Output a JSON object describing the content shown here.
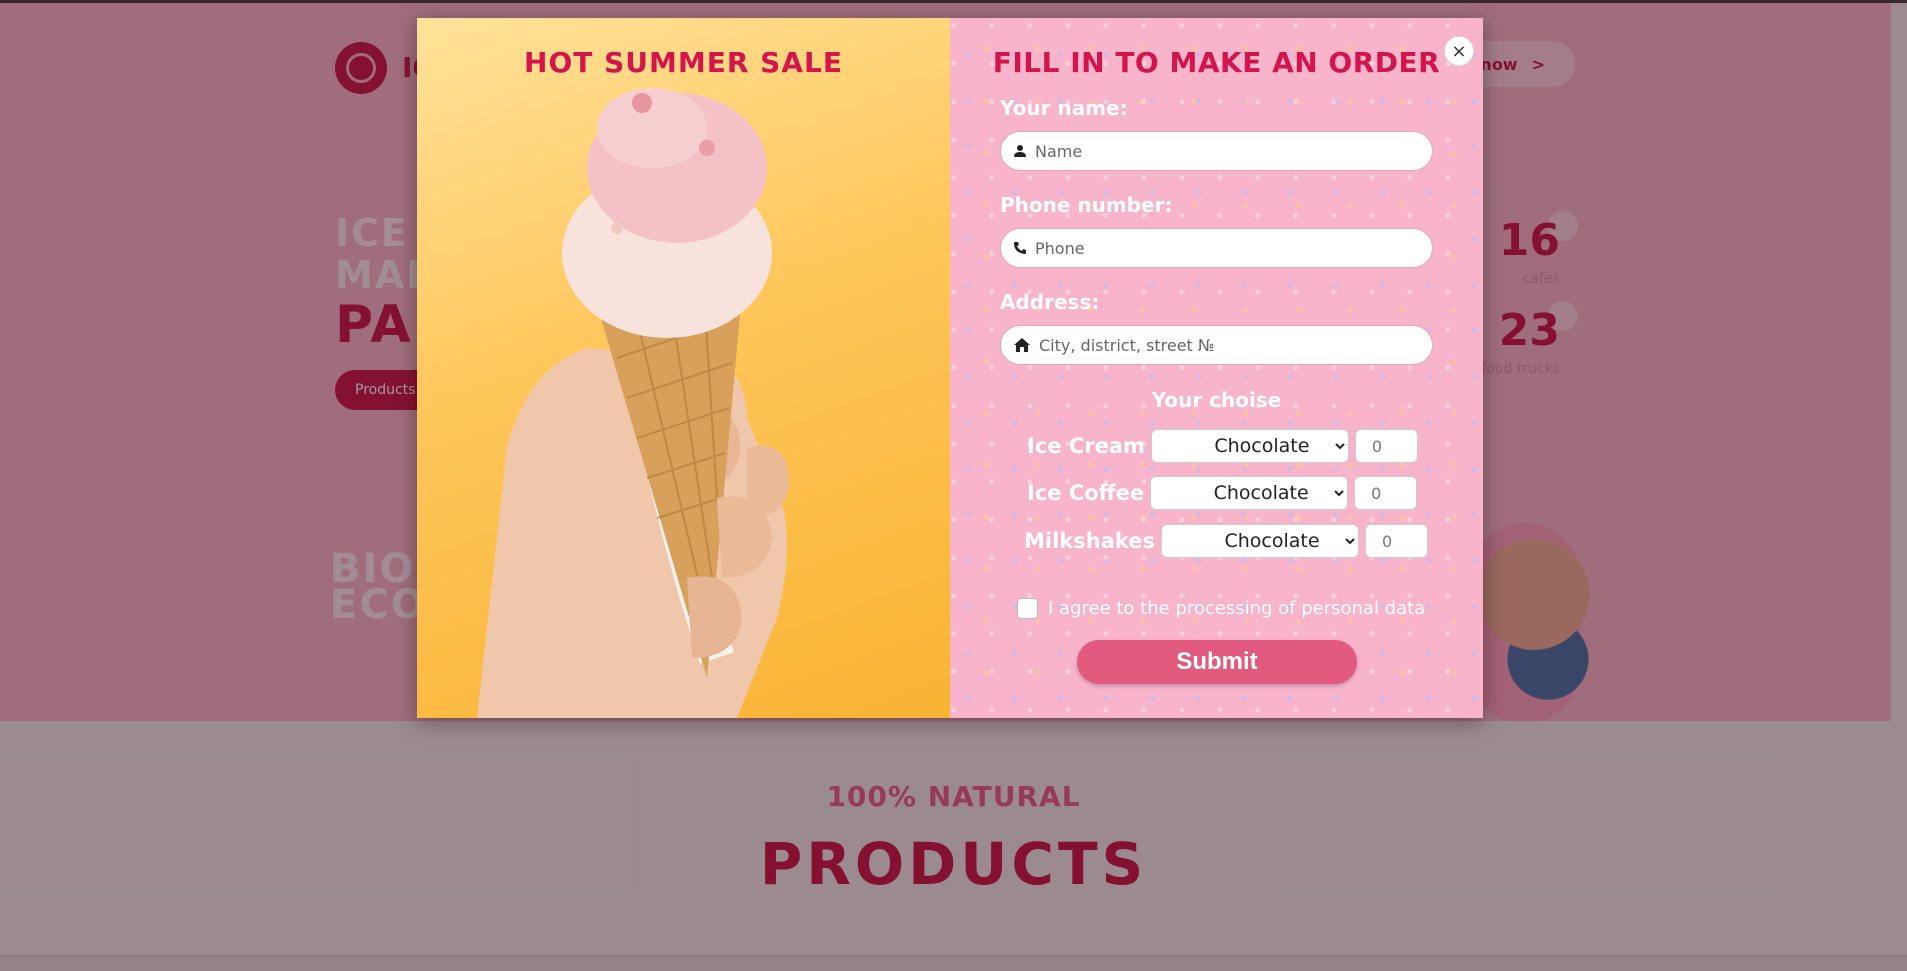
{
  "background": {
    "order_now_label": "now",
    "order_now_arrow": ">",
    "logo_text": "IC",
    "hero_line1": "ICE C",
    "hero_line2": "MAD",
    "hero_line3": "PA",
    "products_button": "Products",
    "bio_line1": "BIO",
    "bio_line2": "ECO",
    "stats": [
      {
        "value": "16",
        "label": "cafes"
      },
      {
        "value": "23",
        "label": "food trucks"
      }
    ],
    "section_kicker": "100% NATURAL",
    "section_title": "PRODUCTS"
  },
  "modal": {
    "left_title": "HOT SUMMER SALE",
    "right_title": "FILL IN TO MAKE AN ORDER",
    "close_label": "×",
    "name_label": "Your name:",
    "name_placeholder": "Name",
    "phone_label": "Phone number:",
    "phone_placeholder": "Phone",
    "address_label": "Address:",
    "address_placeholder": "City, district, street №",
    "choise_title": "Your choise",
    "rows": [
      {
        "label": "Ice Cream",
        "flavor": "Chocolate",
        "qty": "0"
      },
      {
        "label": "Ice Coffee",
        "flavor": "Chocolate",
        "qty": "0"
      },
      {
        "label": "Milkshakes",
        "flavor": "Chocolate",
        "qty": "0"
      }
    ],
    "agree_text": "I agree to the processing of personal data",
    "submit_label": "Submit"
  },
  "colors": {
    "brand": "#c0103f",
    "modal_left_bg": "#ffc65a",
    "modal_right_bg": "#f8b4cb",
    "submit_bg": "#e35a7f"
  }
}
